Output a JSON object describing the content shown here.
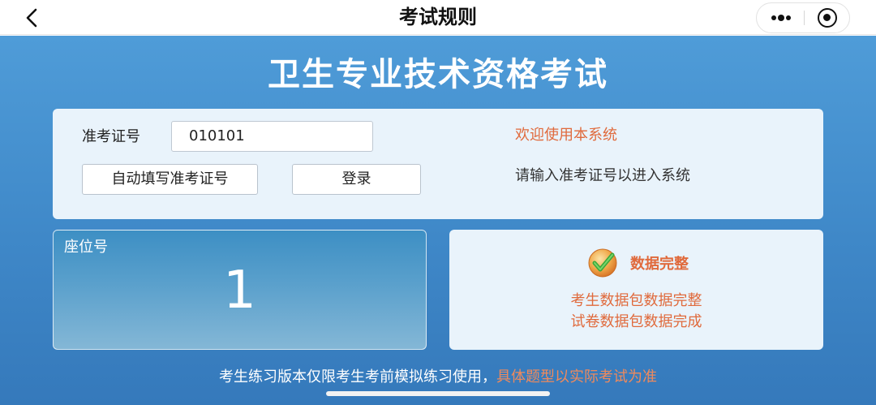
{
  "navbar": {
    "title": "考试规则",
    "back_icon": "chevron-left-icon",
    "menu_icon": "more-dots-icon",
    "close_icon": "target-circle-icon"
  },
  "app": {
    "title": "卫生专业技术资格考试"
  },
  "login": {
    "exam_id_label": "准考证号",
    "exam_id_value": "010101",
    "autofill_button": "自动填写准考证号",
    "login_button": "登录",
    "welcome_text": "欢迎使用本系统",
    "hint_text": "请输入准考证号以进入系统"
  },
  "seat": {
    "label": "座位号",
    "number": "1"
  },
  "data_status": {
    "icon": "check-badge-icon",
    "title": "数据完整",
    "line1": "考生数据包数据完整",
    "line2": "试卷数据包数据完成"
  },
  "footer": {
    "note_plain": "考生练习版本仅限考生考前模拟练习使用，",
    "note_accent": "具体题型以实际考试为准"
  },
  "colors": {
    "accent_orange": "#e06a3c",
    "background_blue": "#3f88c8",
    "panel_light": "#e9f3fb"
  }
}
